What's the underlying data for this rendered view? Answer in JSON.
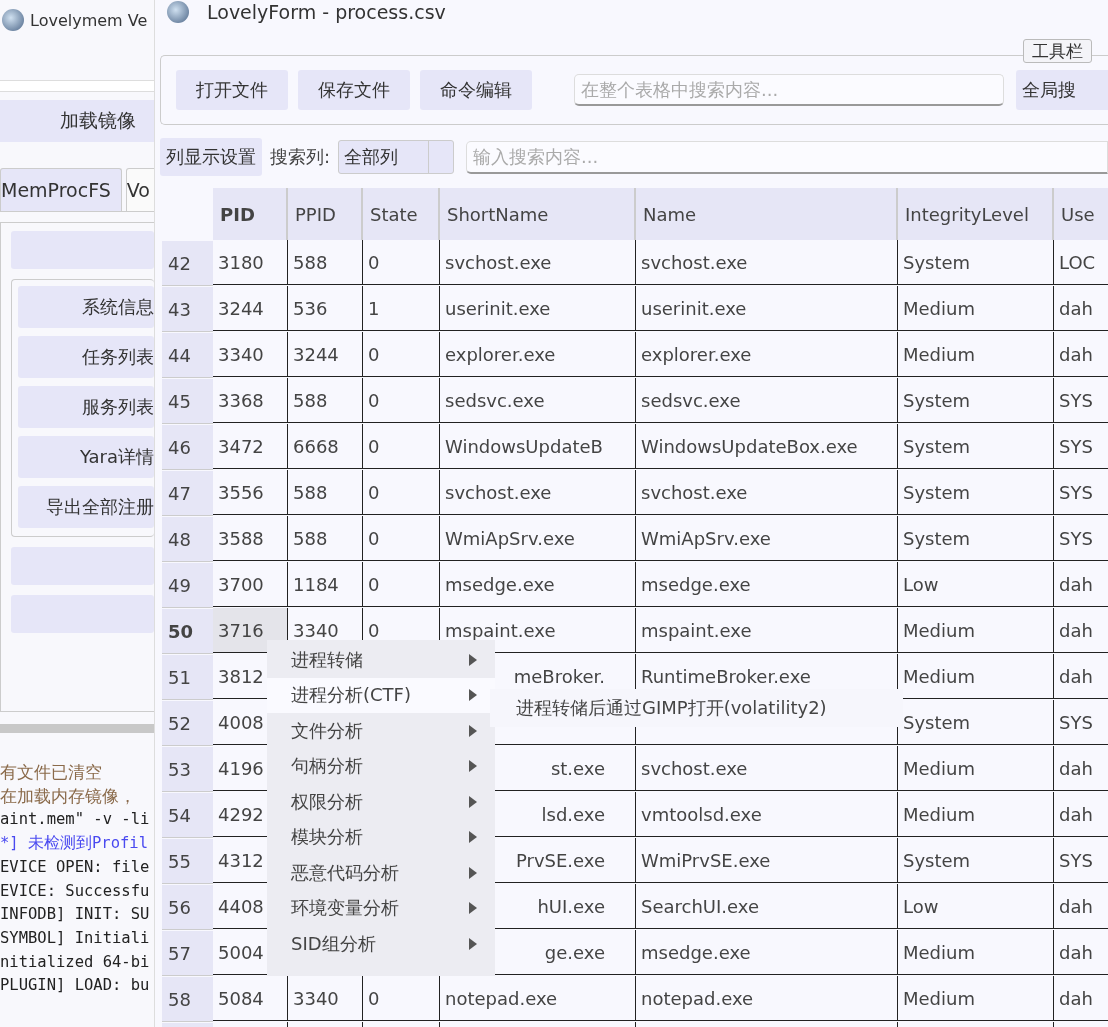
{
  "background_window": {
    "title": "Lovelymem Ve",
    "load_button": "加载镜像",
    "tabs": [
      {
        "label": "MemProcFS",
        "selected": true
      },
      {
        "label": "Vo",
        "selected": false
      }
    ],
    "buttons": [
      "系统信息",
      "任务列表",
      "服务列表",
      "Yara详情",
      "导出全部注册"
    ],
    "log_lines": [
      {
        "kind": "muted",
        "text": "有文件已清空"
      },
      {
        "kind": "muted",
        "text": "在加载内存镜像，"
      },
      {
        "kind": "plain",
        "text": "aint.mem\" -v -li"
      },
      {
        "kind": "notice",
        "text": "*] 未检测到Profil"
      },
      {
        "kind": "plain",
        "text": "EVICE OPEN: file"
      },
      {
        "kind": "plain",
        "text": "EVICE: Successfu"
      },
      {
        "kind": "plain",
        "text": "INFODB] INIT: SU"
      },
      {
        "kind": "plain",
        "text": "SYMBOL] Initiali"
      },
      {
        "kind": "plain",
        "text": "nitialized 64-bi"
      },
      {
        "kind": "plain",
        "text": "PLUGIN] LOAD: bu"
      }
    ]
  },
  "window": {
    "title": "LovelyForm - process.csv"
  },
  "toolbar": {
    "title": "工具栏",
    "buttons": [
      "打开文件",
      "保存文件",
      "命令编辑"
    ],
    "search": {
      "placeholder": "在整个表格中搜索内容..."
    },
    "global_search_button": "全局搜"
  },
  "filter_bar": {
    "column_settings_button": "列显示设置",
    "search_column_label": "搜索列:",
    "column_select": "全部列",
    "search": {
      "placeholder": "输入搜索内容..."
    }
  },
  "table": {
    "columns": [
      "PID",
      "PPID",
      "State",
      "ShortName",
      "Name",
      "IntegrityLevel",
      "Use"
    ],
    "rows": [
      {
        "number": "42",
        "selected": false,
        "cells": [
          "3180",
          "588",
          "0",
          "svchost.exe",
          "svchost.exe",
          "System",
          "LOC"
        ]
      },
      {
        "number": "43",
        "selected": false,
        "cells": [
          "3244",
          "536",
          "1",
          "userinit.exe",
          "userinit.exe",
          "Medium",
          "dah"
        ]
      },
      {
        "number": "44",
        "selected": false,
        "cells": [
          "3340",
          "3244",
          "0",
          "explorer.exe",
          "explorer.exe",
          "Medium",
          "dah"
        ]
      },
      {
        "number": "45",
        "selected": false,
        "cells": [
          "3368",
          "588",
          "0",
          "sedsvc.exe",
          "sedsvc.exe",
          "System",
          "SYS"
        ]
      },
      {
        "number": "46",
        "selected": false,
        "cells": [
          "3472",
          "6668",
          "0",
          "WindowsUpdateB",
          "WindowsUpdateBox.exe",
          "System",
          "SYS"
        ]
      },
      {
        "number": "47",
        "selected": false,
        "cells": [
          "3556",
          "588",
          "0",
          "svchost.exe",
          "svchost.exe",
          "System",
          "SYS"
        ]
      },
      {
        "number": "48",
        "selected": false,
        "cells": [
          "3588",
          "588",
          "0",
          "WmiApSrv.exe",
          "WmiApSrv.exe",
          "System",
          "SYS"
        ]
      },
      {
        "number": "49",
        "selected": false,
        "cells": [
          "3700",
          "1184",
          "0",
          "msedge.exe",
          "msedge.exe",
          "Low",
          "dah"
        ]
      },
      {
        "number": "50",
        "selected": true,
        "cells": [
          "3716",
          "3340",
          "0",
          "mspaint.exe",
          "mspaint.exe",
          "Medium",
          "dah"
        ]
      },
      {
        "number": "51",
        "selected": false,
        "cells": [
          "3812",
          null,
          null,
          {
            "text": "meBroker.",
            "covered": true
          },
          "RuntimeBroker.exe",
          "Medium",
          "dah"
        ]
      },
      {
        "number": "52",
        "selected": false,
        "cells": [
          "4008",
          null,
          null,
          null,
          null,
          "System",
          "SYS"
        ]
      },
      {
        "number": "53",
        "selected": false,
        "cells": [
          "4196",
          null,
          null,
          {
            "text": "st.exe",
            "covered": true
          },
          "svchost.exe",
          "Medium",
          "dah"
        ]
      },
      {
        "number": "54",
        "selected": false,
        "cells": [
          "4292",
          null,
          null,
          {
            "text": "lsd.exe",
            "covered": true
          },
          "vmtoolsd.exe",
          "Medium",
          "dah"
        ]
      },
      {
        "number": "55",
        "selected": false,
        "cells": [
          "4312",
          null,
          null,
          {
            "text": "PrvSE.exe",
            "covered": true
          },
          "WmiPrvSE.exe",
          "System",
          "SYS"
        ]
      },
      {
        "number": "56",
        "selected": false,
        "cells": [
          "4408",
          null,
          null,
          {
            "text": "hUI.exe",
            "covered": true
          },
          "SearchUI.exe",
          "Low",
          "dah"
        ]
      },
      {
        "number": "57",
        "selected": false,
        "cells": [
          "5004",
          null,
          null,
          {
            "text": "ge.exe",
            "covered": true
          },
          "msedge.exe",
          "Medium",
          "dah"
        ]
      },
      {
        "number": "58",
        "selected": false,
        "cells": [
          "5084",
          "3340",
          "0",
          "notepad.exe",
          "notepad.exe",
          "Medium",
          "dah"
        ]
      }
    ]
  },
  "context_menu": {
    "items": [
      {
        "label": "进程转储",
        "selected": false
      },
      {
        "label": "进程分析(CTF)",
        "selected": true
      },
      {
        "label": "文件分析",
        "selected": false
      },
      {
        "label": "句柄分析",
        "selected": false
      },
      {
        "label": "权限分析",
        "selected": false
      },
      {
        "label": "模块分析",
        "selected": false
      },
      {
        "label": "恶意代码分析",
        "selected": false
      },
      {
        "label": "环境变量分析",
        "selected": false
      },
      {
        "label": "SID组分析",
        "selected": false
      }
    ],
    "submenu": {
      "items": [
        "进程转储后通过GIMP打开(volatility2)"
      ]
    }
  }
}
